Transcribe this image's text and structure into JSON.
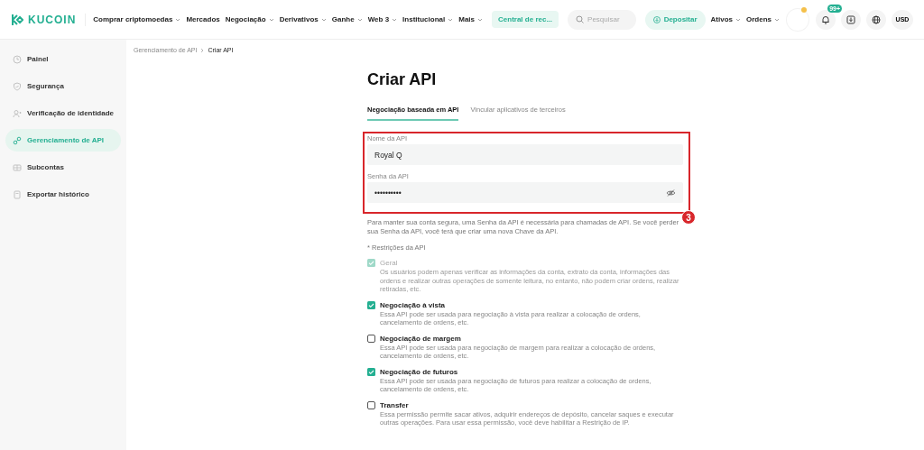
{
  "header": {
    "logo": "KUCOIN",
    "nav": [
      {
        "label": "Comprar criptomoedas",
        "has_menu": true
      },
      {
        "label": "Mercados",
        "has_menu": false
      },
      {
        "label": "Negociação",
        "has_menu": true
      },
      {
        "label": "Derivativos",
        "has_menu": true
      },
      {
        "label": "Ganhe",
        "has_menu": true
      },
      {
        "label": "Web 3",
        "has_menu": true
      },
      {
        "label": "Institucional",
        "has_menu": true
      },
      {
        "label": "Mais",
        "has_menu": true
      }
    ],
    "promo": "Central de rec...",
    "search": {
      "placeholder": "Pesquisar"
    },
    "deposit": "Depositar",
    "menus": [
      {
        "label": "Ativos",
        "has_menu": true
      },
      {
        "label": "Ordens",
        "has_menu": true
      }
    ],
    "notification_badge": "99+",
    "currency": "USD"
  },
  "sidebar": {
    "items": [
      {
        "label": "Painel",
        "selected": false
      },
      {
        "label": "Segurança",
        "selected": false
      },
      {
        "label": "Verificação de identidade",
        "selected": false
      },
      {
        "label": "Gerenciamento de API",
        "selected": true
      },
      {
        "label": "Subcontas",
        "selected": false
      },
      {
        "label": "Exportar histórico",
        "selected": false
      }
    ]
  },
  "breadcrumb": [
    "Gerenciamento de API",
    "Criar API"
  ],
  "page_title": "Criar API",
  "tabs": [
    {
      "label": "Negociação baseada em API",
      "selected": true
    },
    {
      "label": "Vincular aplicativos de terceiros",
      "selected": false
    }
  ],
  "form": {
    "fields": [
      {
        "kind": "text",
        "label": "Nome da API",
        "value": "Royal Q"
      },
      {
        "kind": "password",
        "label": "Senha da API",
        "value": "••••••••••"
      }
    ],
    "annotation": "3",
    "help": "Para manter sua conta segura, uma Senha da API é necessária para chamadas de API. Se você perder sua Senha da API, você terá que criar uma nova Chave da API.",
    "restrictions": {
      "label": "* Restrições da API",
      "items": [
        {
          "title": "Geral",
          "description": "Os usuários podem apenas verificar as informações da conta, extrato da conta, informações das ordens e realizar outras operações de somente leitura, no entanto, não podem criar ordens, realizar retiradas, etc.",
          "checked": true,
          "disabled": true
        },
        {
          "title": "Negociação à vista",
          "description": "Essa API pode ser usada para negociação à vista para realizar a colocação de ordens, cancelamento de ordens, etc.",
          "checked": true,
          "disabled": false
        },
        {
          "title": "Negociação de margem",
          "description": "Essa API pode ser usada para negociação de margem para realizar a colocação de ordens, cancelamento de ordens, etc.",
          "checked": false,
          "disabled": false
        },
        {
          "title": "Negociação de futuros",
          "description": "Essa API pode ser usada para negociação de futuros para realizar a colocação de ordens, cancelamento de ordens, etc.",
          "checked": true,
          "disabled": false
        },
        {
          "title": "Transfer",
          "description": "Essa permissão permite sacar ativos, adquirir endereços de depósito, cancelar saques e executar outras operações. Para usar essa permissão, você deve habilitar a Restrição de IP.",
          "checked": false,
          "disabled": false
        }
      ]
    }
  }
}
